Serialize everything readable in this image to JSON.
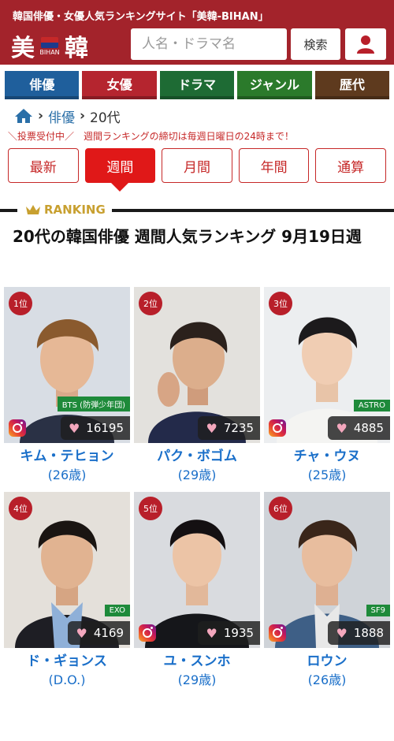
{
  "header": {
    "tagline": "韓国俳優・女優人気ランキングサイト「美韓-BIHAN」",
    "logo_left": "美",
    "logo_small": "BIHAN",
    "logo_right": "韓",
    "search_placeholder": "人名・ドラマ名",
    "search_button": "検索",
    "user_icon": "user-icon"
  },
  "nav": {
    "tabs": [
      {
        "label": "俳優",
        "color": "#1f5f9c"
      },
      {
        "label": "女優",
        "color": "#b5252f"
      },
      {
        "label": "ドラマ",
        "color": "#1e6b34"
      },
      {
        "label": "ジャンル",
        "color": "#2b7a2b"
      },
      {
        "label": "歴代",
        "color": "#5e3a1e"
      }
    ]
  },
  "breadcrumb": {
    "home_icon": "home-icon",
    "items": [
      "俳優",
      "20代"
    ]
  },
  "notice": {
    "status": "＼投票受付中／",
    "text": "週間ランキングの締切は毎週日曜日の24時まで！"
  },
  "period_tabs": [
    "最新",
    "週間",
    "月間",
    "年間",
    "通算"
  ],
  "active_period": "週間",
  "ranking_label": "RANKING",
  "page_title": "20代の韓国俳優 週間人気ランキング 9月19日週",
  "cards": [
    {
      "rank": "1位",
      "group": "BTS (防弾少年団)",
      "likes": "16195",
      "name": "キム・テヒョン",
      "age": "(26歳)",
      "instagram": true
    },
    {
      "rank": "2位",
      "group": "",
      "likes": "7235",
      "name": "パク・ボゴム",
      "age": "(29歳)",
      "instagram": false
    },
    {
      "rank": "3位",
      "group": "ASTRO",
      "likes": "4885",
      "name": "チャ・ウヌ",
      "age": "(25歳)",
      "instagram": true
    },
    {
      "rank": "4位",
      "group": "EXO",
      "likes": "4169",
      "name": "ド・ギョンス",
      "age": "(D.O.)",
      "instagram": false
    },
    {
      "rank": "5位",
      "group": "",
      "likes": "1935",
      "name": "ユ・スンホ",
      "age": "(29歳)",
      "instagram": true
    },
    {
      "rank": "6位",
      "group": "SF9",
      "likes": "1888",
      "name": "ロウン",
      "age": "(26歳)",
      "instagram": true
    }
  ],
  "colors": {
    "brand": "#a3232b",
    "accent_red": "#e01818",
    "link_blue": "#1a6fc9",
    "group_badge": "#1e8a3a"
  }
}
